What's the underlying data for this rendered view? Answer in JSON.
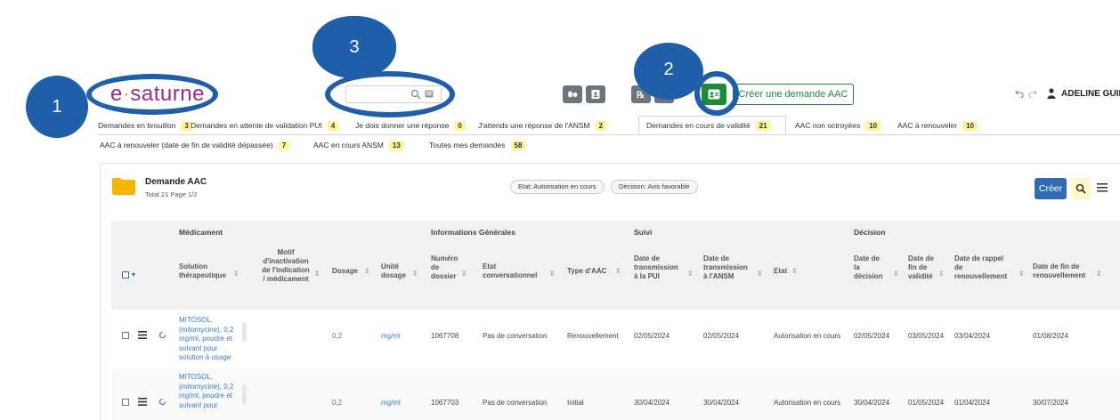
{
  "logo": {
    "part1": "e",
    "part2": "·",
    "part3": "saturne"
  },
  "search": {
    "value": "",
    "placeholder": ""
  },
  "toolbar": {
    "create_aac_label": "Créer une demande AAC"
  },
  "user": {
    "name": "ADELINE GUILLAUME"
  },
  "tabs_row1": [
    {
      "label": "Demandes en brouillon",
      "count": "3"
    },
    {
      "label": "Demandes en attente de validation PUI",
      "count": "4"
    },
    {
      "label": "Je dois donner une réponse",
      "count": "0"
    },
    {
      "label": "J'attends une réponse de l'ANSM",
      "count": "2"
    },
    {
      "label": "Demandes en cours de validité",
      "count": "21"
    },
    {
      "label": "AAC non octroyées",
      "count": "10"
    },
    {
      "label": "AAC à renouveler",
      "count": "10"
    }
  ],
  "tabs_row2": [
    {
      "label": "AAC à renouveler (date de fin de validité dépassée)",
      "count": "7"
    },
    {
      "label": "AAC en cours ANSM",
      "count": "13"
    },
    {
      "label": "Toutes mes demandes",
      "count": "58"
    }
  ],
  "panel": {
    "title": "Demande AAC",
    "subtitle": "Total 21  Page 1/2",
    "filter_etat": "Etat: Autorisation en cours",
    "filter_decision": "Décision: Avis favorable",
    "create_label": "Créer"
  },
  "groups": {
    "medicament": "Médicament",
    "infos": "Informations Générales",
    "suivi": "Suivi",
    "decision": "Décision"
  },
  "headers": {
    "solution": [
      "Solution",
      "thérapeutique"
    ],
    "motif": [
      "Motif",
      "d'inactivation",
      "de l'indication",
      "/ médicament"
    ],
    "dosage": [
      "Dosage"
    ],
    "unite": [
      "Unité",
      "dosage"
    ],
    "numero": [
      "Numéro",
      "de",
      "dossier"
    ],
    "etat_conv": [
      "Etat",
      "conversationnel"
    ],
    "type": [
      "Type d'AAC"
    ],
    "date_pui": [
      "Date de",
      "transmission",
      "à la PUI"
    ],
    "date_ansm": [
      "Date de",
      "transmission",
      "à l'ANSM"
    ],
    "etat": [
      "Etat"
    ],
    "date_decision": [
      "Date de",
      "la",
      "décision"
    ],
    "date_fin": [
      "Date de",
      "fin de",
      "validité"
    ],
    "date_rappel": [
      "Date de rappel",
      "de",
      "renouvellement"
    ],
    "date_fin_renouv": [
      "Date de fin de",
      "renouvellement"
    ]
  },
  "rows": [
    {
      "medicament": [
        "MITOSOL,",
        "(mitomycine), 0,2",
        "mg/ml, poudre et",
        "solvant pour",
        "solution à usage"
      ],
      "dosage": "0,2",
      "unite": "mg/ml",
      "numero": "1067708",
      "etat_conv": "Pas de conversation",
      "type": "Renouvellement",
      "date_pui": "02/05/2024",
      "date_ansm": "02/05/2024",
      "etat": "Autorisation en cours",
      "date_decision": "02/05/2024",
      "date_fin": "03/05/2024",
      "date_rappel": "03/04/2024",
      "date_fin_renouv": "01/08/2024"
    },
    {
      "medicament": [
        "MITOSOL,",
        "(mitomycine), 0,2",
        "mg/ml, poudre et",
        "solvant pour"
      ],
      "dosage": "0,2",
      "unite": "mg/ml",
      "numero": "1067703",
      "etat_conv": "Pas de conversation",
      "type": "Initial",
      "date_pui": "30/04/2024",
      "date_ansm": "30/04/2024",
      "etat": "Autorisation en cours",
      "date_decision": "30/04/2024",
      "date_fin": "01/05/2024",
      "date_rappel": "01/04/2024",
      "date_fin_renouv": "30/07/2024"
    }
  ],
  "annotations": [
    "1",
    "2",
    "3"
  ],
  "colors": {
    "annotation": "#1f5ea8",
    "logo_purple": "#9b2a8e",
    "logo_orange": "#f0a500",
    "green": "#1e8a3a",
    "primary": "#2f6cb5",
    "count_badge": "#fff59d",
    "link": "#3b7bc4"
  },
  "icons": [
    "search-icon",
    "keyboard-icon",
    "pills-icon",
    "id-card-icon",
    "prescription-icon",
    "contact-card-icon",
    "undo-icon",
    "redo-icon",
    "user-icon",
    "folder-icon",
    "menu-icon",
    "refresh-icon",
    "checkbox-icon"
  ]
}
